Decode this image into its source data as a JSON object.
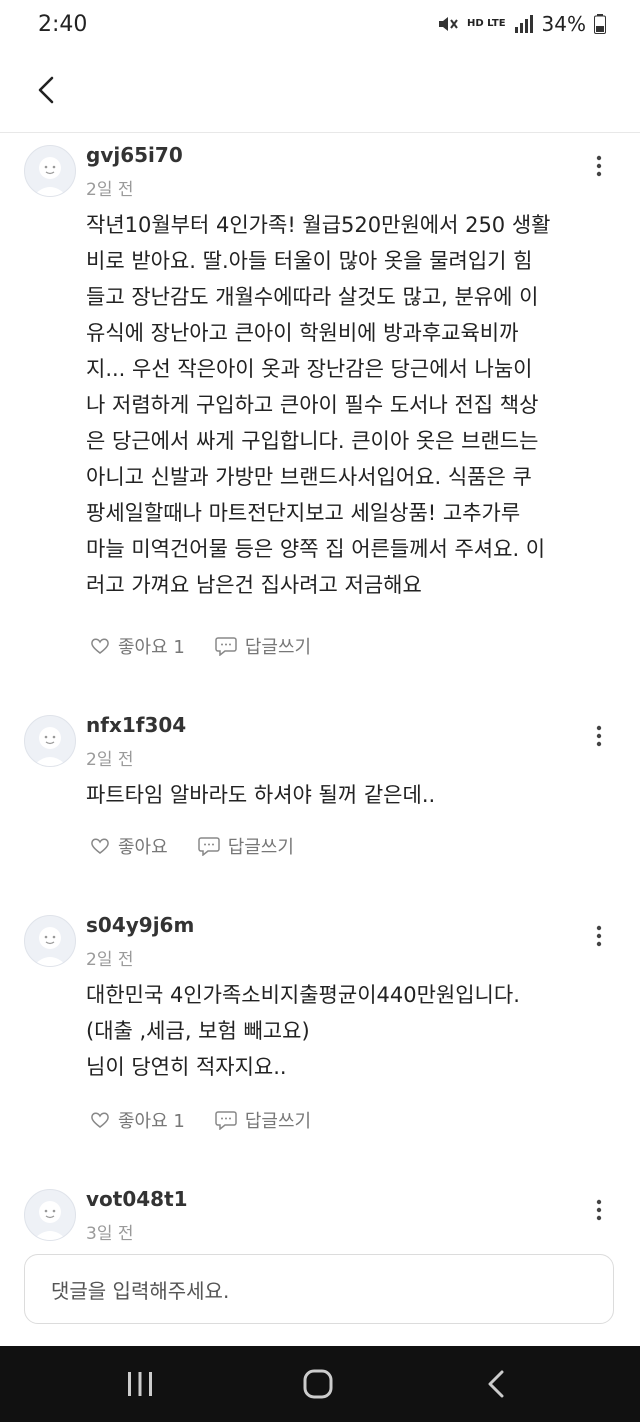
{
  "status_bar": {
    "time": "2:40",
    "network": "HD LTE",
    "battery": "34%"
  },
  "comments": [
    {
      "username": "gvj65i70",
      "time_ago": "2일 전",
      "text": "작년10월부터 4인가족! 월급520만원에서 250 생활\n비로 받아요. 딸.아들 터울이 많아 옷을 물려입기 힘\n들고 장난감도 개월수에따라 살것도 많고, 분유에 이\n유식에 장난아고 큰아이 학원비에 방과후교육비까\n지... 우선 작은아이 옷과 장난감은 당근에서 나눔이\n나 저렴하게 구입하고 큰아이 필수 도서나 전집 책상\n은 당근에서 싸게 구입합니다. 큰이아 옷은 브랜드는\n아니고 신발과 가방만 브랜드사서입어요. 식품은 쿠\n팡세일할때나 마트전단지보고 세일상품! 고추가루\n마늘 미역건어물 등은 양쪽 집 어른들께서 주셔요. 이\n러고 가껴요 남은건 집사려고 저금해요",
      "like_label": "좋아요 1",
      "reply_label": "답글쓰기"
    },
    {
      "username": "nfx1f304",
      "time_ago": "2일 전",
      "text": "파트타임 알바라도 하셔야 될꺼 같은데..",
      "like_label": "좋아요",
      "reply_label": "답글쓰기"
    },
    {
      "username": "s04y9j6m",
      "time_ago": "2일 전",
      "text": "대한민국 4인가족소비지출평균이440만원입니다.\n(대출 ,세금, 보험 빼고요)\n님이  당연히 적자지요..",
      "like_label": "좋아요 1",
      "reply_label": "답글쓰기"
    },
    {
      "username": "vot048t1",
      "time_ago": "3일 전"
    }
  ],
  "input": {
    "placeholder": "댓글을 입력해주세요."
  },
  "icons": {
    "back": "chevron-left-icon",
    "more": "more-vertical-icon",
    "like": "heart-icon",
    "reply": "speech-bubble-icon",
    "nav_recents": "recents-icon",
    "nav_home": "home-icon",
    "nav_back": "back-icon"
  }
}
